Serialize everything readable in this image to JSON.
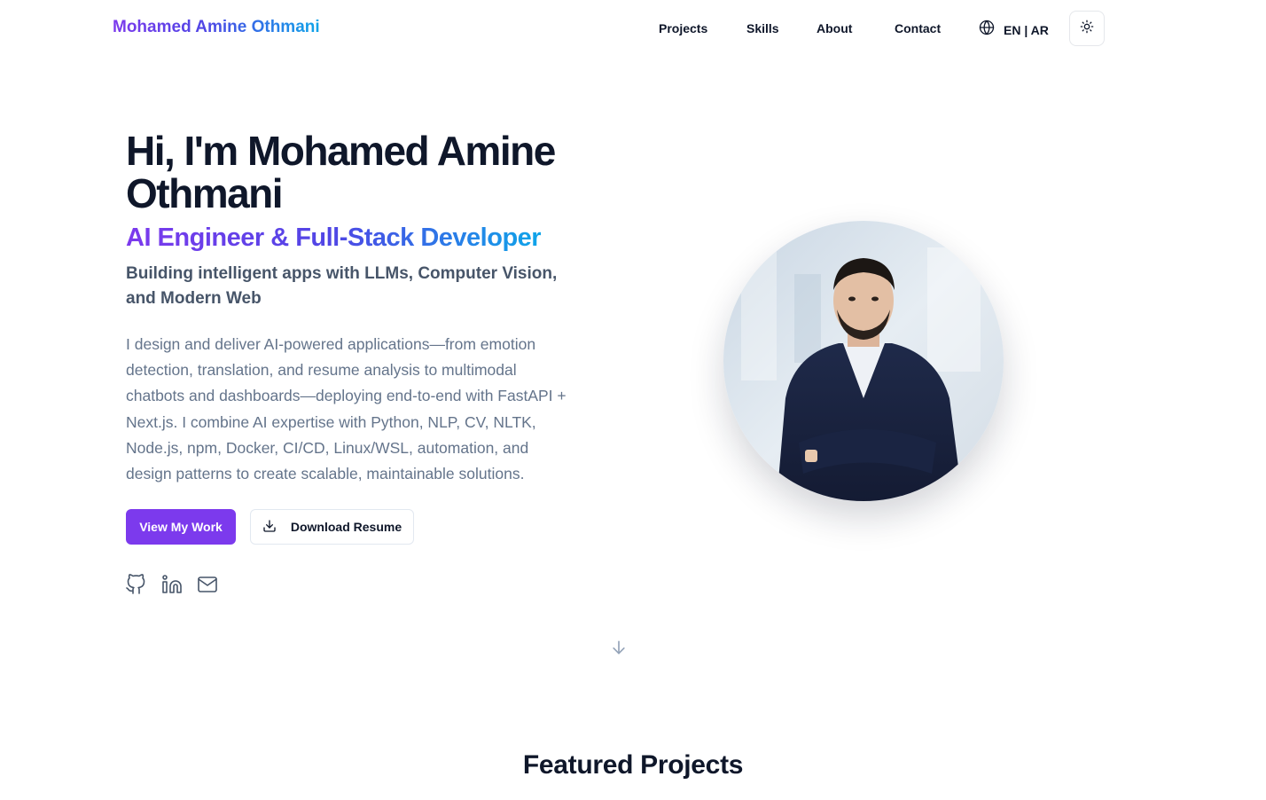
{
  "header": {
    "brand": "Mohamed Amine Othmani",
    "nav": [
      {
        "label": "Projects"
      },
      {
        "label": "Skills"
      },
      {
        "label": "About"
      },
      {
        "label": "Contact"
      }
    ],
    "language_label": "EN | AR",
    "icons": {
      "language": "globe-icon",
      "theme": "sun-icon"
    }
  },
  "hero": {
    "title": "Hi, I'm Mohamed Amine Othmani",
    "role": "AI Engineer & Full-Stack Developer",
    "subtitle": "Building intelligent apps with LLMs, Computer Vision, and Modern Web",
    "description": "I design and deliver AI-powered applications—from emotion detection, translation, and resume analysis to multimodal chatbots and dashboards—deploying end-to-end with FastAPI + Next.js. I combine AI expertise with Python, NLP, CV, NLTK, Node.js, npm, Docker, CI/CD, Linux/WSL, automation, and design patterns to create scalable, maintainable solutions.",
    "primary_button": "View My Work",
    "secondary_button": "Download Resume",
    "secondary_button_icon": "download-icon",
    "social_icons": [
      "github-icon",
      "linkedin-icon",
      "mail-icon"
    ],
    "scroll_icon": "arrow-down-icon"
  },
  "featured": {
    "title": "Featured Projects"
  },
  "colors": {
    "accent": "#7c3aed",
    "gradient_start": "#7c3aed",
    "gradient_end": "#0ea5e9",
    "text": "#0f172a",
    "muted": "#64748b"
  }
}
